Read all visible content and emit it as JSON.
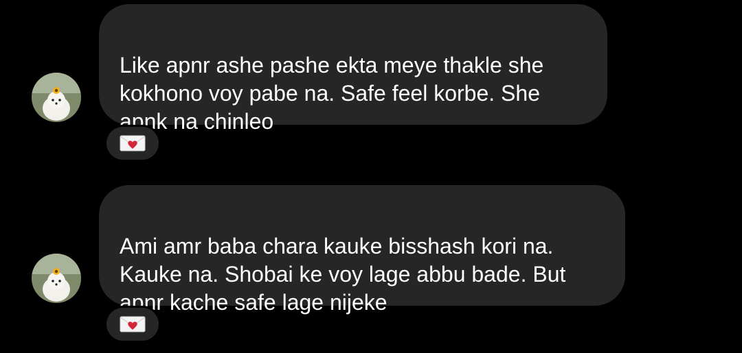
{
  "thread": {
    "messages": [
      {
        "text": "Like apnr ashe pashe ekta meye thakle she\nkokhono voy pabe na. Safe feel korbe. She\napnk na chinleo",
        "reaction_icon": "love-letter-icon"
      },
      {
        "text": "Ami amr baba chara kauke bisshash kori na.\nKauke na. Shobai ke voy lage abbu bade. But\napnr kache safe lage nijeke",
        "reaction_icon": "love-letter-icon"
      }
    ]
  },
  "colors": {
    "background": "#000000",
    "bubble": "#262626",
    "text": "#ffffff",
    "heart": "#d3263a"
  }
}
